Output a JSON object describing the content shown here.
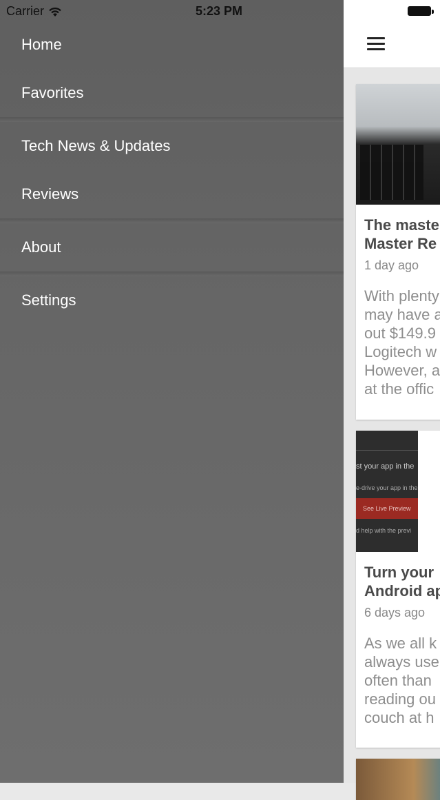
{
  "status_bar": {
    "carrier": "Carrier",
    "time": "5:23 PM"
  },
  "menu": {
    "items": [
      {
        "label": "Home"
      },
      {
        "label": "Favorites"
      },
      {
        "label": "Tech News & Updates"
      },
      {
        "label": "Reviews"
      },
      {
        "label": "About"
      },
      {
        "label": "Settings"
      }
    ]
  },
  "feed": {
    "cards": [
      {
        "title_lines": [
          "The maste",
          "Master Re"
        ],
        "date": "1 day ago",
        "excerpt_lines": [
          "With plenty",
          "may have a",
          "out $149.9",
          "Logitech w",
          "However, a",
          "at the offic"
        ]
      },
      {
        "title_lines": [
          "Turn your",
          "Android ap"
        ],
        "date": "6 days ago",
        "excerpt_lines": [
          "As we all k",
          "always use",
          "often than",
          "reading ou",
          "couch at h"
        ],
        "thumb_text": {
          "line1": "st your app in the",
          "line2": "e-drive your app in the",
          "button": "See Live Preview",
          "line3": "d help with the previ"
        }
      }
    ]
  },
  "colors": {
    "drawer_bg": "#666666",
    "menu_text": "#ffffff",
    "card_title": "#4a4a4a",
    "card_meta": "#888888"
  }
}
